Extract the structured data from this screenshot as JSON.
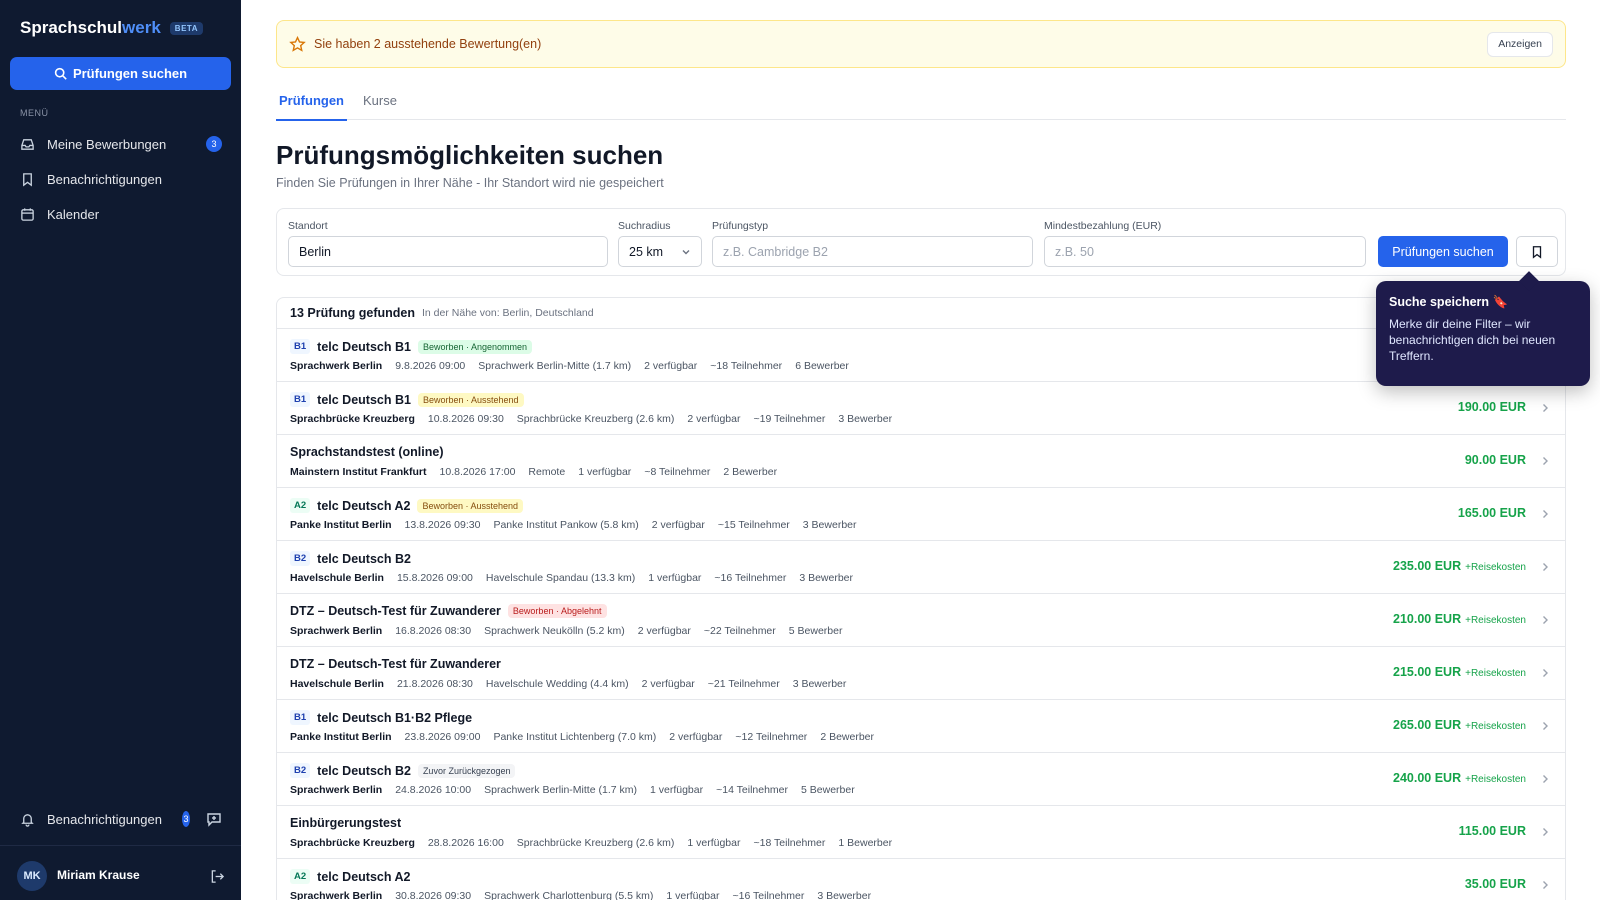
{
  "sidebar": {
    "brand_main": "Sprachschul",
    "brand_accent": "werk",
    "beta": "BETA",
    "search_button": "Prüfungen suchen",
    "menu_label": "MENÜ",
    "items": [
      {
        "label": "Meine Bewerbungen",
        "badge": "3",
        "icon": "inbox-icon"
      },
      {
        "label": "Benachrichtigungen",
        "icon": "bookmark-icon"
      },
      {
        "label": "Kalender",
        "icon": "calendar-icon"
      }
    ],
    "bottom_notifications": {
      "label": "Benachrichtigungen",
      "badge": "3"
    },
    "user": {
      "initials": "MK",
      "name": "Miriam Krause"
    }
  },
  "alert": {
    "text": "Sie haben 2 ausstehende Bewertung(en)",
    "button": "Anzeigen"
  },
  "tabs": [
    {
      "label": "Prüfungen",
      "active": true
    },
    {
      "label": "Kurse",
      "active": false
    }
  ],
  "page": {
    "title": "Prüfungsmöglichkeiten suchen",
    "subtitle": "Finden Sie Prüfungen in Ihrer Nähe - Ihr Standort wird nie gespeichert"
  },
  "filters": {
    "location": {
      "label": "Standort",
      "value": "Berlin"
    },
    "radius": {
      "label": "Suchradius",
      "value": "25 km"
    },
    "type": {
      "label": "Prüfungstyp",
      "placeholder": "z.B. Cambridge B2"
    },
    "min_pay": {
      "label": "Mindestbezahlung (EUR)",
      "placeholder": "z.B. 50"
    },
    "search_button": "Prüfungen suchen"
  },
  "tooltip": {
    "title": "Suche speichern 🔖",
    "body": "Merke dir deine Filter – wir benachrichtigen dich bei neuen Treffern."
  },
  "results": {
    "count": "13 Prüfung gefunden",
    "near": "In der Nähe von: Berlin, Deutschland",
    "rows": [
      {
        "level": "B1",
        "title": "telc Deutsch B1",
        "status": "Beworben · Angenommen",
        "status_type": "green",
        "org": "Sprachwerk Berlin",
        "date": "9.8.2026 09:00",
        "place": "Sprachwerk Berlin-Mitte (1.7 km)",
        "avail": "2 verfügbar",
        "part": "~18 Teilnehmer",
        "app": "6 Bewerber",
        "price": "",
        "extra": ""
      },
      {
        "level": "B1",
        "title": "telc Deutsch B1",
        "status": "Beworben · Ausstehend",
        "status_type": "yellow",
        "org": "Sprachbrücke Kreuzberg",
        "date": "10.8.2026 09:30",
        "place": "Sprachbrücke Kreuzberg (2.6 km)",
        "avail": "2 verfügbar",
        "part": "~19 Teilnehmer",
        "app": "3 Bewerber",
        "price": "190.00 EUR",
        "extra": ""
      },
      {
        "level": "",
        "title": "Sprachstandstest (online)",
        "status": "",
        "status_type": "",
        "org": "Mainstern Institut Frankfurt",
        "date": "10.8.2026 17:00",
        "place": "Remote",
        "avail": "1 verfügbar",
        "part": "~8 Teilnehmer",
        "app": "2 Bewerber",
        "price": "90.00 EUR",
        "extra": ""
      },
      {
        "level": "A2",
        "title": "telc Deutsch A2",
        "status": "Beworben · Ausstehend",
        "status_type": "yellow",
        "org": "Panke Institut Berlin",
        "date": "13.8.2026 09:30",
        "place": "Panke Institut Pankow (5.8 km)",
        "avail": "2 verfügbar",
        "part": "~15 Teilnehmer",
        "app": "3 Bewerber",
        "price": "165.00 EUR",
        "extra": ""
      },
      {
        "level": "B2",
        "title": "telc Deutsch B2",
        "status": "",
        "status_type": "",
        "org": "Havelschule Berlin",
        "date": "15.8.2026 09:00",
        "place": "Havelschule Spandau (13.3 km)",
        "avail": "1 verfügbar",
        "part": "~16 Teilnehmer",
        "app": "3 Bewerber",
        "price": "235.00 EUR",
        "extra": "+Reisekosten"
      },
      {
        "level": "",
        "title": "DTZ – Deutsch-Test für Zuwanderer",
        "status": "Beworben · Abgelehnt",
        "status_type": "red",
        "org": "Sprachwerk Berlin",
        "date": "16.8.2026 08:30",
        "place": "Sprachwerk Neukölln (5.2 km)",
        "avail": "2 verfügbar",
        "part": "~22 Teilnehmer",
        "app": "5 Bewerber",
        "price": "210.00 EUR",
        "extra": "+Reisekosten"
      },
      {
        "level": "",
        "title": "DTZ – Deutsch-Test für Zuwanderer",
        "status": "",
        "status_type": "",
        "org": "Havelschule Berlin",
        "date": "21.8.2026 08:30",
        "place": "Havelschule Wedding (4.4 km)",
        "avail": "2 verfügbar",
        "part": "~21 Teilnehmer",
        "app": "3 Bewerber",
        "price": "215.00 EUR",
        "extra": "+Reisekosten"
      },
      {
        "level": "B1",
        "title": "telc Deutsch B1·B2 Pflege",
        "status": "",
        "status_type": "",
        "org": "Panke Institut Berlin",
        "date": "23.8.2026 09:00",
        "place": "Panke Institut Lichtenberg (7.0 km)",
        "avail": "2 verfügbar",
        "part": "~12 Teilnehmer",
        "app": "2 Bewerber",
        "price": "265.00 EUR",
        "extra": "+Reisekosten"
      },
      {
        "level": "B2",
        "title": "telc Deutsch B2",
        "status": "Zuvor Zurückgezogen",
        "status_type": "gray",
        "org": "Sprachwerk Berlin",
        "date": "24.8.2026 10:00",
        "place": "Sprachwerk Berlin-Mitte (1.7 km)",
        "avail": "1 verfügbar",
        "part": "~14 Teilnehmer",
        "app": "5 Bewerber",
        "price": "240.00 EUR",
        "extra": "+Reisekosten"
      },
      {
        "level": "",
        "title": "Einbürgerungstest",
        "status": "",
        "status_type": "",
        "org": "Sprachbrücke Kreuzberg",
        "date": "28.8.2026 16:00",
        "place": "Sprachbrücke Kreuzberg (2.6 km)",
        "avail": "1 verfügbar",
        "part": "~18 Teilnehmer",
        "app": "1 Bewerber",
        "price": "115.00 EUR",
        "extra": ""
      },
      {
        "level": "A2",
        "title": "telc Deutsch A2",
        "status": "",
        "status_type": "",
        "org": "Sprachwerk Berlin",
        "date": "30.8.2026 09:30",
        "place": "Sprachwerk Charlottenburg (5.5 km)",
        "avail": "1 verfügbar",
        "part": "~16 Teilnehmer",
        "app": "3 Bewerber",
        "price": "35.00 EUR",
        "extra": ""
      }
    ]
  },
  "colors": {
    "accent": "#2563eb",
    "sidebar": "#0f1a30",
    "price": "#16a34a",
    "tooltip": "#1e1b4b"
  }
}
